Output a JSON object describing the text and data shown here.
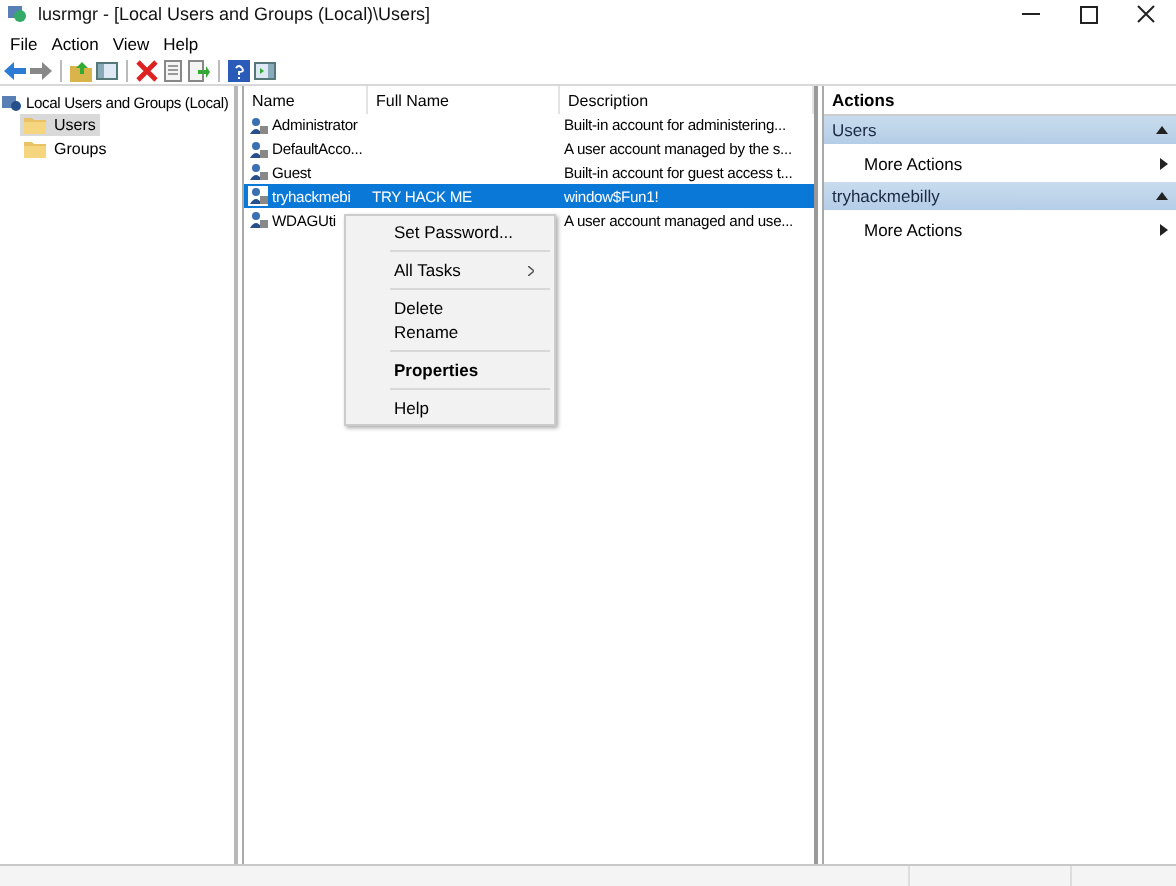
{
  "window": {
    "title": "lusrmgr - [Local Users and Groups (Local)\\Users]"
  },
  "menu": [
    "File",
    "Action",
    "View",
    "Help"
  ],
  "tree": {
    "root": "Local Users and Groups (Local)",
    "children": [
      {
        "label": "Users",
        "selected": true
      },
      {
        "label": "Groups",
        "selected": false
      }
    ]
  },
  "table": {
    "columns": [
      "Name",
      "Full Name",
      "Description"
    ],
    "rows": [
      {
        "name": "Administrator",
        "full_name": "",
        "description": "Built-in account for administering...",
        "selected": false
      },
      {
        "name": "DefaultAcco...",
        "full_name": "",
        "description": "A user account managed by the s...",
        "selected": false
      },
      {
        "name": "Guest",
        "full_name": "",
        "description": "Built-in account for guest access t...",
        "selected": false
      },
      {
        "name": "tryhackmebi",
        "full_name": "TRY HACK ME",
        "description": "window$Fun1!",
        "selected": true
      },
      {
        "name": "WDAGUti",
        "full_name": "",
        "description": "A user account managed and use...",
        "selected": false
      }
    ]
  },
  "context_menu": {
    "groups": [
      [
        {
          "label": "Set Password...",
          "default": false,
          "submenu": false
        }
      ],
      [
        {
          "label": "All Tasks",
          "default": false,
          "submenu": true
        }
      ],
      [
        {
          "label": "Delete",
          "default": false,
          "submenu": false
        },
        {
          "label": "Rename",
          "default": false,
          "submenu": false
        }
      ],
      [
        {
          "label": "Properties",
          "default": true,
          "submenu": false
        }
      ],
      [
        {
          "label": "Help",
          "default": false,
          "submenu": false
        }
      ]
    ]
  },
  "actions": {
    "title": "Actions",
    "sections": [
      {
        "title": "Users",
        "items": [
          "More Actions"
        ]
      },
      {
        "title": "tryhackmebilly",
        "items": [
          "More Actions"
        ]
      }
    ]
  }
}
